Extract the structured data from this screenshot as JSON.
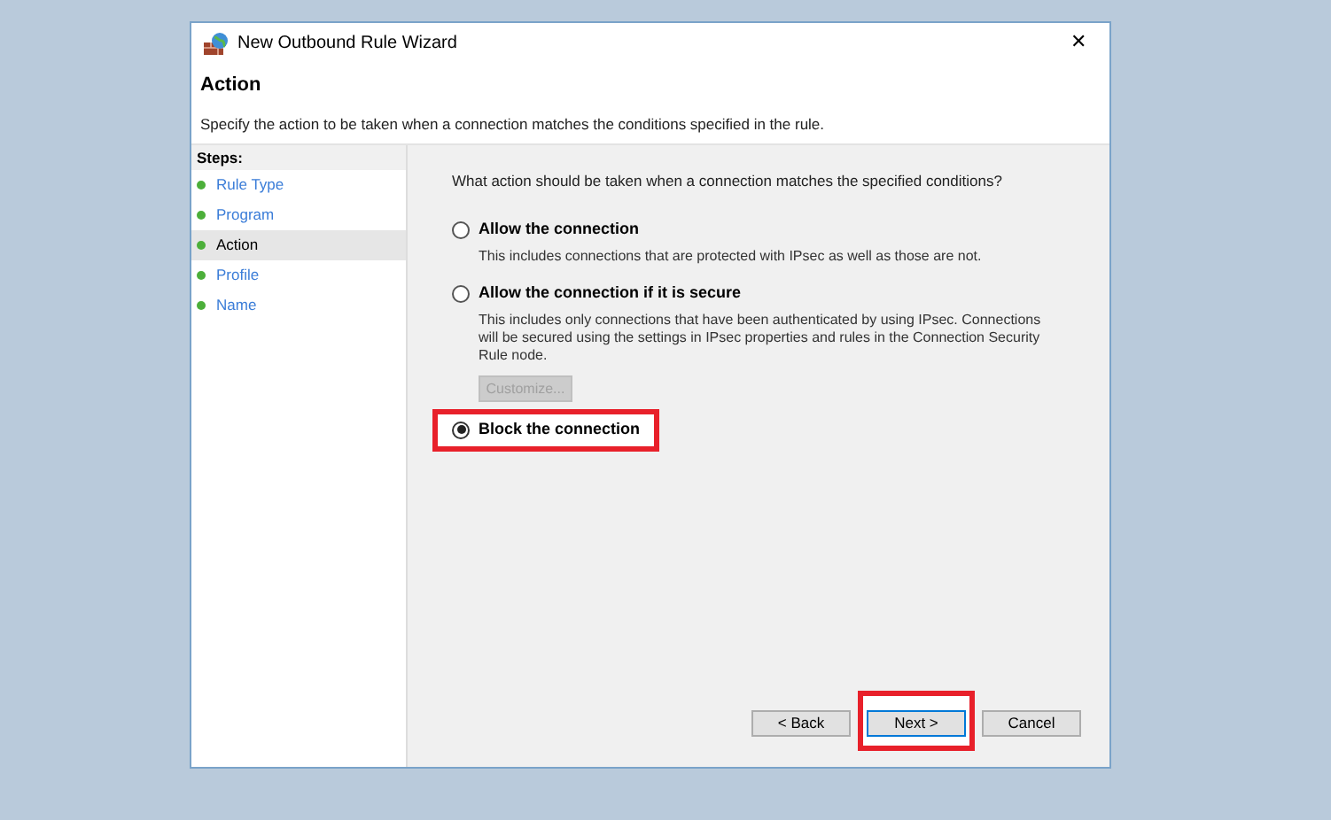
{
  "window": {
    "title": "New Outbound Rule Wizard",
    "close": "✕"
  },
  "header": {
    "title": "Action",
    "description": "Specify the action to be taken when a connection matches the conditions specified in the rule."
  },
  "steps": {
    "title": "Steps:",
    "items": [
      {
        "label": "Rule Type",
        "selected": false
      },
      {
        "label": "Program",
        "selected": false
      },
      {
        "label": "Action",
        "selected": true
      },
      {
        "label": "Profile",
        "selected": false
      },
      {
        "label": "Name",
        "selected": false
      }
    ]
  },
  "question": "What action should be taken when a connection matches the specified conditions?",
  "options": [
    {
      "label": "Allow the connection",
      "selected": false,
      "highlighted": false,
      "description": "This includes connections that are protected with IPsec as well as those are not."
    },
    {
      "label": "Allow the connection if it is secure",
      "selected": false,
      "highlighted": false,
      "description": "This includes only connections that have been authenticated by using IPsec.  Connections will be secured using the settings in IPsec properties and rules in the Connection Security Rule node.",
      "button": {
        "label": "Customize...",
        "disabled": true
      }
    },
    {
      "label": "Block the connection",
      "selected": true,
      "highlighted": true
    }
  ],
  "buttons": [
    {
      "label": "< Back",
      "default": false,
      "highlighted": false
    },
    {
      "label": "Next >",
      "default": true,
      "highlighted": true
    },
    {
      "label": "Cancel",
      "default": false,
      "highlighted": false
    }
  ]
}
